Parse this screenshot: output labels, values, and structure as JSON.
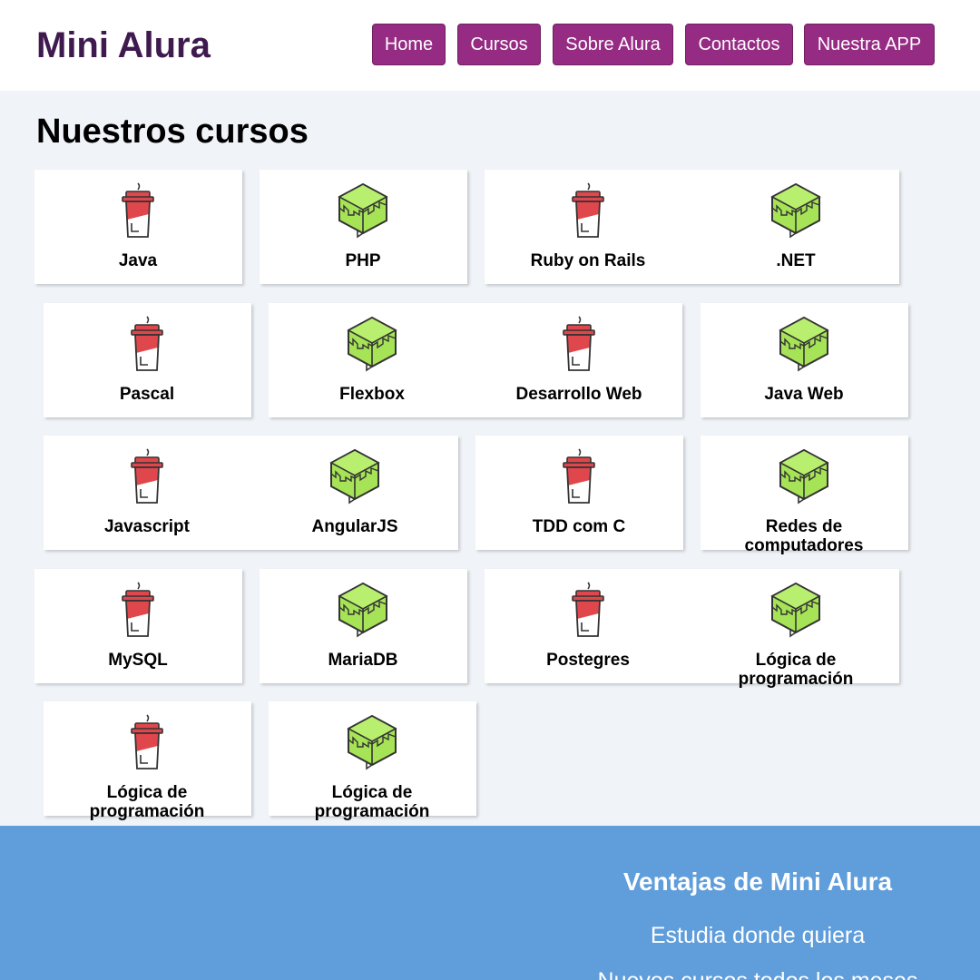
{
  "header": {
    "logo": "Mini Alura",
    "nav": [
      "Home",
      "Cursos",
      "Sobre Alura",
      "Contactos",
      "Nuestra APP"
    ]
  },
  "courses_title": "Nuestros cursos",
  "courses": [
    {
      "name": "Java",
      "icon": "coffee-cup-icon"
    },
    {
      "name": "PHP",
      "icon": "green-cube-icon"
    },
    {
      "name": "Ruby on Rails",
      "icon": "coffee-cup-icon"
    },
    {
      "name": ".NET",
      "icon": "green-cube-icon"
    },
    {
      "name": "Pascal",
      "icon": "coffee-cup-icon"
    },
    {
      "name": "Flexbox",
      "icon": "green-cube-icon"
    },
    {
      "name": "Desarrollo Web",
      "icon": "coffee-cup-icon"
    },
    {
      "name": "Java Web",
      "icon": "green-cube-icon"
    },
    {
      "name": "Javascript",
      "icon": "coffee-cup-icon"
    },
    {
      "name": "AngularJS",
      "icon": "green-cube-icon"
    },
    {
      "name": "TDD com C",
      "icon": "coffee-cup-icon"
    },
    {
      "name": "Redes de computadores",
      "icon": "green-cube-icon"
    },
    {
      "name": "MySQL",
      "icon": "coffee-cup-icon"
    },
    {
      "name": "MariaDB",
      "icon": "green-cube-icon"
    },
    {
      "name": "Postegres",
      "icon": "coffee-cup-icon"
    },
    {
      "name": "Lógica de programación",
      "icon": "green-cube-icon"
    },
    {
      "name": "Lógica de programación",
      "icon": "coffee-cup-icon"
    },
    {
      "name": "Lógica de programación",
      "icon": "green-cube-icon"
    }
  ],
  "footer": {
    "title": "Ventajas de Mini Alura",
    "items": [
      "Estudia donde quiera",
      "Nuevos cursos todos los meses"
    ]
  },
  "colors": {
    "nav_button": "#962b83",
    "logo": "#3f1a4f",
    "footer_bg": "#5f9ddb",
    "cup_red": "#e0474c",
    "cube_green": "#a6e356"
  }
}
